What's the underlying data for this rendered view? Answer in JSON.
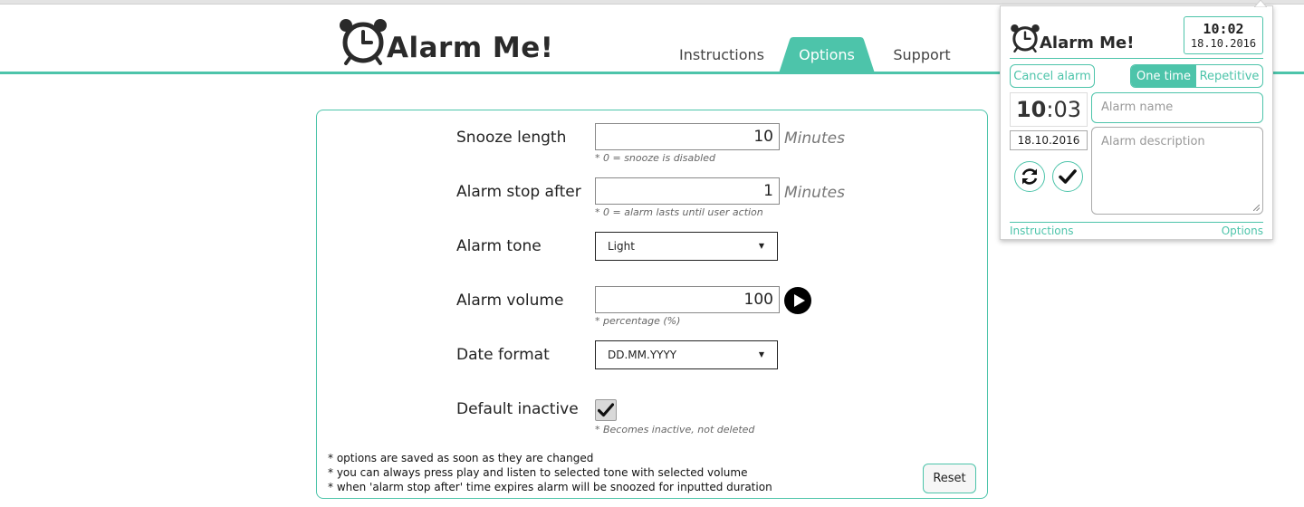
{
  "app": {
    "name": "Alarm Me!",
    "accent_color": "#4dc4aa"
  },
  "nav": {
    "tabs": [
      {
        "label": "Instructions",
        "active": false
      },
      {
        "label": "Options",
        "active": true
      },
      {
        "label": "Support",
        "active": false
      }
    ]
  },
  "options": {
    "snooze": {
      "label": "Snooze length",
      "value": "10",
      "unit": "Minutes",
      "hint": "* 0 = snooze is disabled"
    },
    "stop_after": {
      "label": "Alarm stop after",
      "value": "1",
      "unit": "Minutes",
      "hint": "* 0 = alarm lasts until user action"
    },
    "tone": {
      "label": "Alarm tone",
      "selected": "Light",
      "caret": "▼"
    },
    "volume": {
      "label": "Alarm volume",
      "value": "100",
      "hint": "* percentage (%)",
      "play_icon": "play-icon"
    },
    "date_format": {
      "label": "Date format",
      "selected": "DD.MM.YYYY",
      "caret": "▼"
    },
    "default_inactive": {
      "label": "Default inactive",
      "checked": true,
      "hint": "* Becomes inactive, not deleted"
    },
    "footnotes": [
      "* options are saved as soon as they are changed",
      "* you can always press play and listen to selected tone with selected volume",
      "* when 'alarm stop after' time expires alarm will be snoozed for inputted duration"
    ],
    "reset_label": "Reset"
  },
  "popup": {
    "logo_text": "Alarm Me!",
    "clock_time": "10:02",
    "clock_date": "18.10.2016",
    "cancel_label": "Cancel alarm",
    "mode_one_time": "One time",
    "mode_repetitive": "Repetitive",
    "alarm_hours": "10",
    "alarm_sep": ":",
    "alarm_minutes": "03",
    "alarm_date": "18.10.2016",
    "name_placeholder": "Alarm name",
    "description_placeholder": "Alarm description",
    "link_instructions": "Instructions",
    "link_options": "Options"
  }
}
